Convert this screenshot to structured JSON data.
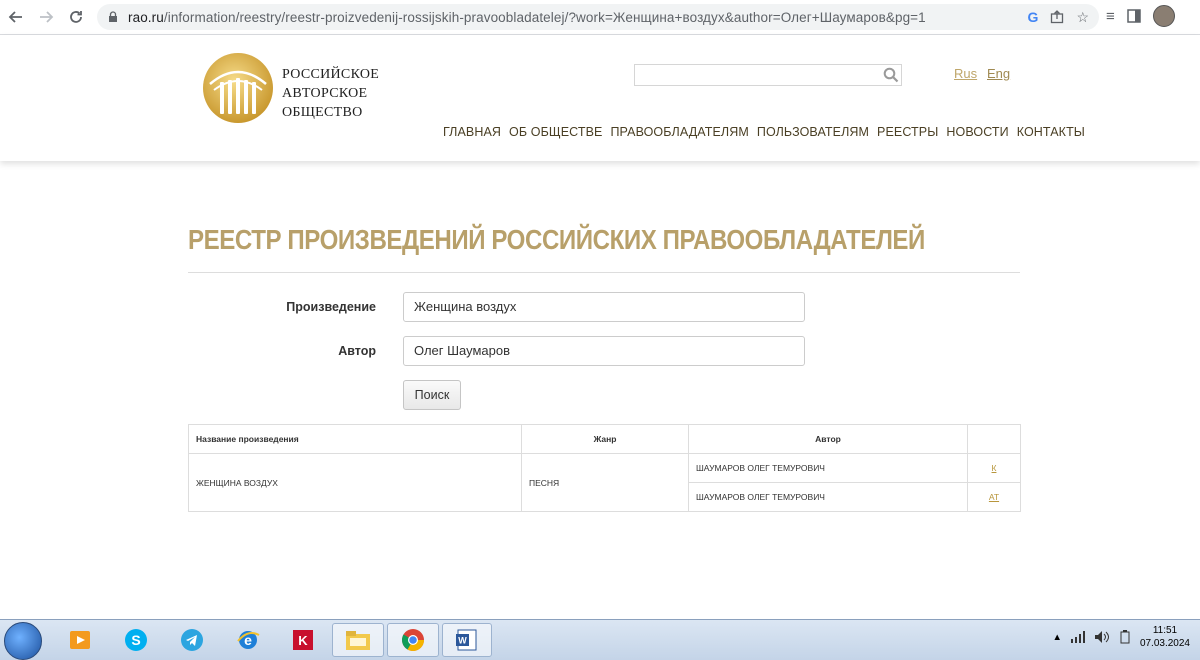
{
  "browser": {
    "url_host": "rao.ru",
    "url_path": "/information/reestry/reestr-proizvedenij-rossijskih-pravoobladatelej/?work=Женщина+воздух&author=Олег+Шаумаров&pg=1"
  },
  "header": {
    "logo_line1": "РОССИЙСКОЕ",
    "logo_line2": "АВТОРСКОЕ",
    "logo_line3": "ОБЩЕСТВО",
    "lang_rus": "Rus",
    "lang_eng": "Eng",
    "nav": [
      "ГЛАВНАЯ",
      "ОБ ОБЩЕСТВЕ",
      "ПРАВООБЛАДАТЕЛЯМ",
      "ПОЛЬЗОВАТЕЛЯМ",
      "РЕЕСТРЫ",
      "НОВОСТИ",
      "КОНТАКТЫ"
    ]
  },
  "page": {
    "title": "РЕЕСТР ПРОИЗВЕДЕНИЙ РОССИЙСКИХ ПРАВООБЛАДАТЕЛЕЙ"
  },
  "form": {
    "work_label": "Произведение",
    "work_value": "Женщина воздух",
    "author_label": "Автор",
    "author_value": "Олег Шаумаров",
    "search_button": "Поиск"
  },
  "table": {
    "headers": [
      "Название произведения",
      "Жанр",
      "Автор",
      ""
    ],
    "work": "ЖЕНЩИНА ВОЗДУХ",
    "genre": "ПЕСНЯ",
    "authors": [
      {
        "name": "ШАУМАРОВ ОЛЕГ ТЕМУРОВИЧ",
        "code": "К"
      },
      {
        "name": "ШАУМАРОВ ОЛЕГ ТЕМУРОВИЧ",
        "code": "АТ"
      }
    ]
  },
  "taskbar": {
    "time": "11:51",
    "date": "07.03.2024"
  },
  "colors": {
    "accent_gold": "#b8a06a",
    "link_gold": "#b8963c"
  }
}
